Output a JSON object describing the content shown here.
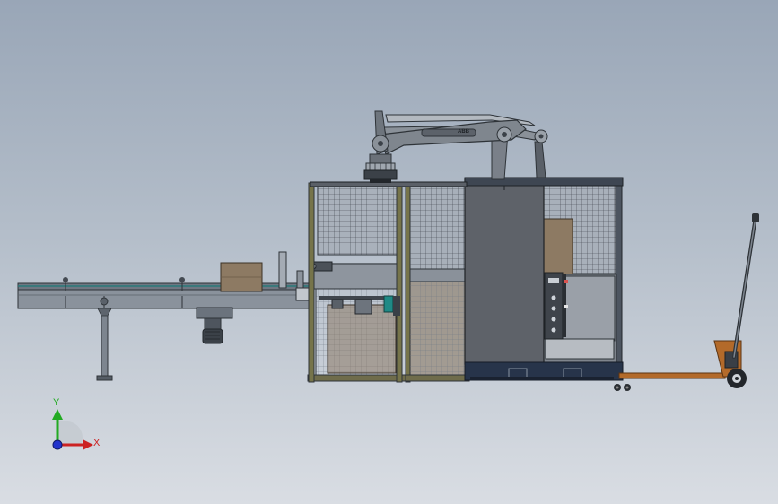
{
  "viewport": {
    "background_top": "#99a6b7",
    "background_bottom": "#d9dde3"
  },
  "robot": {
    "name_plate": "ABB"
  },
  "triad": {
    "x_label": "X",
    "y_label": "Y",
    "x_color": "#cc2222",
    "y_color": "#22aa22",
    "z_color": "#2233cc"
  },
  "colors": {
    "frame_green": "#76744a",
    "steel": "#5f6670",
    "cabinet": "#5e6269",
    "box": "#8d7a63",
    "pallet_jack": "#b36a2a",
    "base_blue": "#27344a",
    "teal_valve": "#1f8a86"
  }
}
